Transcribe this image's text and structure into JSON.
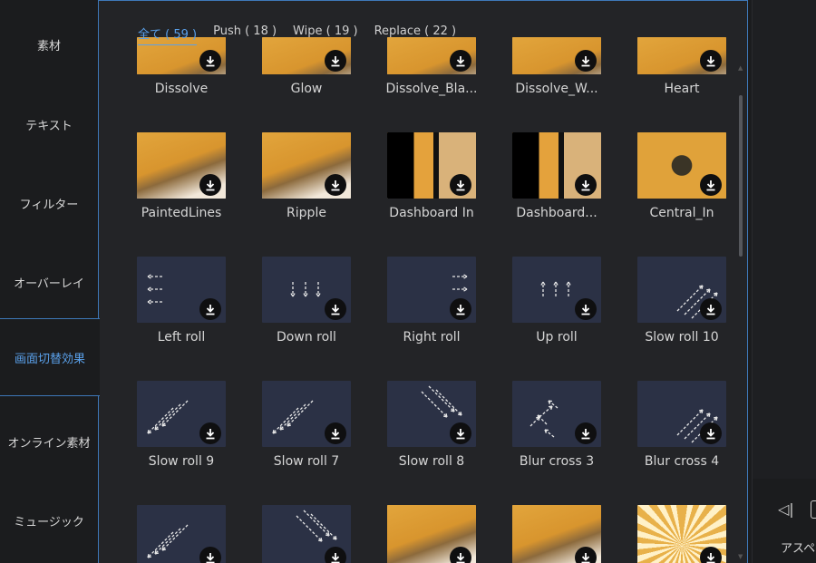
{
  "sidebar": {
    "items": [
      {
        "label": "素材"
      },
      {
        "label": "テキスト"
      },
      {
        "label": "フィルター"
      },
      {
        "label": "オーバーレイ"
      },
      {
        "label": "画面切替効果"
      },
      {
        "label": "オンライン素材"
      },
      {
        "label": "ミュージック"
      }
    ]
  },
  "tabs": [
    {
      "label": "全て ( 59 )"
    },
    {
      "label": "Push ( 18 )"
    },
    {
      "label": "Wipe ( 19 )"
    },
    {
      "label": "Replace ( 22 )"
    }
  ],
  "rows": [
    [
      {
        "label": "Dissolve",
        "kind": "photo"
      },
      {
        "label": "Glow",
        "kind": "photo"
      },
      {
        "label": "Dissolve_Bla...",
        "kind": "photo"
      },
      {
        "label": "Dissolve_W...",
        "kind": "photo"
      },
      {
        "label": "Heart",
        "kind": "photo"
      }
    ],
    [
      {
        "label": "PaintedLines",
        "kind": "photo"
      },
      {
        "label": "Ripple",
        "kind": "photo"
      },
      {
        "label": "Dashboard In",
        "kind": "photo"
      },
      {
        "label": "Dashboard...",
        "kind": "photo"
      },
      {
        "label": "Central_In",
        "kind": "photo"
      }
    ],
    [
      {
        "label": "Left roll",
        "kind": "arrow",
        "icon": "arrows-left-icon"
      },
      {
        "label": "Down roll",
        "kind": "arrow",
        "icon": "arrows-down-icon"
      },
      {
        "label": "Right roll",
        "kind": "arrow",
        "icon": "arrows-right-icon"
      },
      {
        "label": "Up roll",
        "kind": "arrow",
        "icon": "arrows-up-icon"
      },
      {
        "label": "Slow roll 10",
        "kind": "arrow",
        "icon": "arrows-diagonal-up-right-icon"
      }
    ],
    [
      {
        "label": "Slow roll 9",
        "kind": "arrow",
        "icon": "arrows-diagonal-down-left-icon"
      },
      {
        "label": "Slow roll 7",
        "kind": "arrow",
        "icon": "arrows-diagonal-down-left-icon"
      },
      {
        "label": "Slow roll 8",
        "kind": "arrow",
        "icon": "arrows-diagonal-down-right-icon"
      },
      {
        "label": "Blur cross 3",
        "kind": "arrow",
        "icon": "arrows-cross-icon"
      },
      {
        "label": "Blur cross 4",
        "kind": "arrow",
        "icon": "arrows-diagonal-up-right-icon"
      }
    ],
    [
      {
        "label": "",
        "kind": "arrow",
        "icon": "arrows-diagonal-down-left-icon"
      },
      {
        "label": "",
        "kind": "arrow",
        "icon": "arrows-diagonal-down-right-icon"
      },
      {
        "label": "",
        "kind": "photo"
      },
      {
        "label": "",
        "kind": "photo"
      },
      {
        "label": "",
        "kind": "photo"
      }
    ]
  ],
  "right_panel": {
    "label": "アスペ"
  },
  "colors": {
    "accent": "#5aa0ea",
    "border": "#3e78b8",
    "thumb_arrow_bg": "#2b3145",
    "photo_orange": "#e0a23a"
  }
}
